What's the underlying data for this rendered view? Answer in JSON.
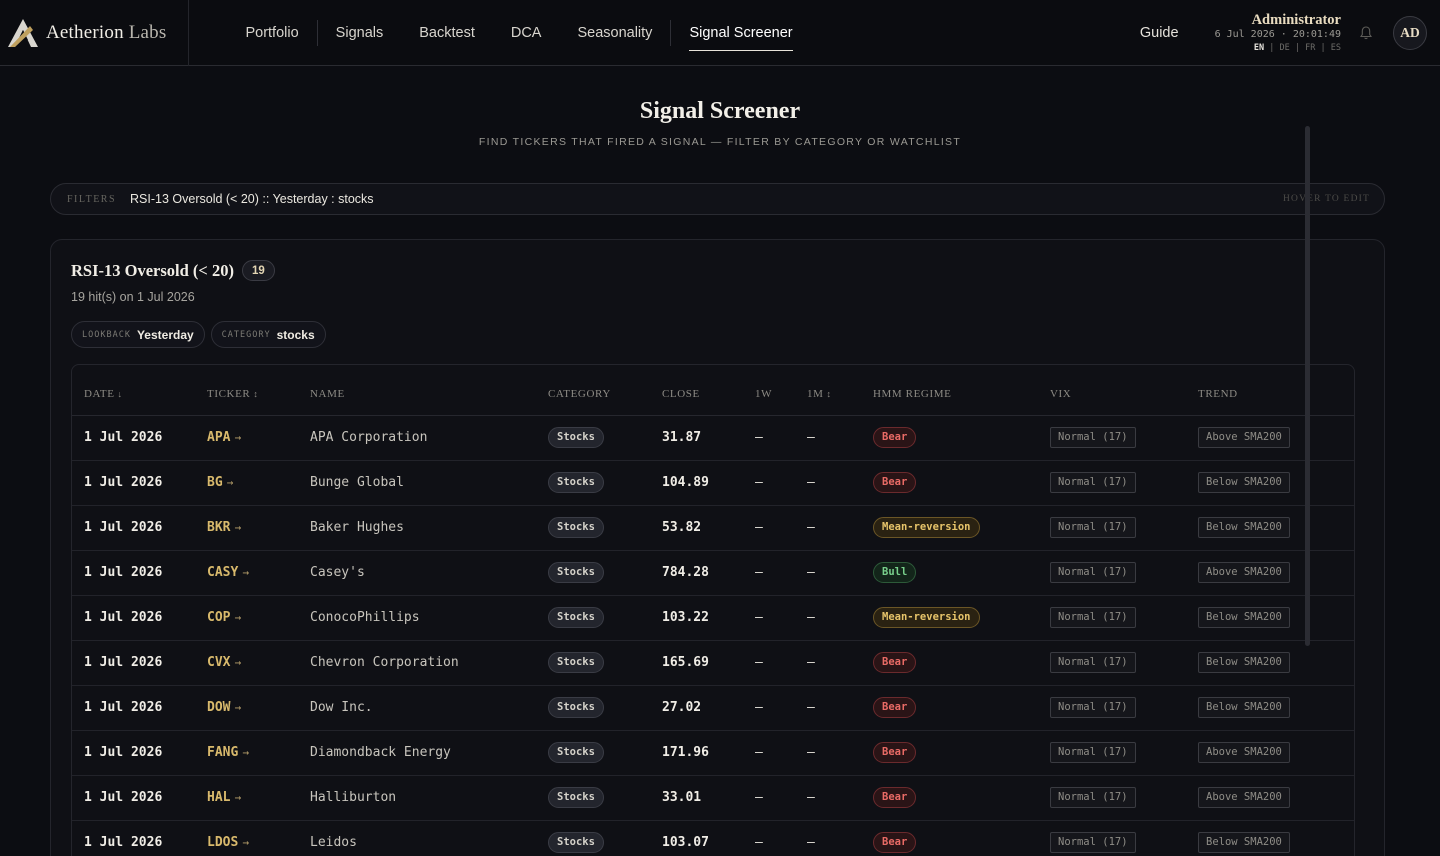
{
  "brand": {
    "name_bold": "Aetherion",
    "name_light": "Labs"
  },
  "nav": {
    "items": [
      {
        "label": "Portfolio"
      },
      {
        "label": "Signals"
      },
      {
        "label": "Backtest"
      },
      {
        "label": "DCA"
      },
      {
        "label": "Seasonality"
      },
      {
        "label": "Signal Screener",
        "active": true
      }
    ],
    "guide": "Guide"
  },
  "user": {
    "name": "Administrator",
    "datetime": "6 Jul 2026 · 20:01:49",
    "initials": "AD",
    "languages": [
      "EN",
      "DE",
      "FR",
      "ES"
    ],
    "active_language": "EN"
  },
  "header": {
    "title": "Signal Screener",
    "subtitle": "FIND TICKERS THAT FIRED A SIGNAL — FILTER BY CATEGORY OR WATCHLIST"
  },
  "filters": {
    "label": "FILTERS",
    "value": "RSI-13 Oversold (< 20) :: Yesterday : stocks",
    "hint": "HOVER TO EDIT"
  },
  "card": {
    "title": "RSI-13 Oversold (< 20)",
    "count": "19",
    "subtitle": "19 hit(s) on 1 Jul 2026",
    "chips": [
      {
        "key": "LOOKBACK",
        "value": "Yesterday"
      },
      {
        "key": "CATEGORY",
        "value": "stocks"
      }
    ]
  },
  "table": {
    "columns": [
      "DATE",
      "TICKER",
      "NAME",
      "CATEGORY",
      "CLOSE",
      "1W",
      "1M",
      "HMM REGIME",
      "VIX",
      "TREND"
    ],
    "rows": [
      {
        "date": "1 Jul 2026",
        "ticker": "APA",
        "name": "APA Corporation",
        "category": "Stocks",
        "close": "31.87",
        "w1": "—",
        "m1": "—",
        "regime": "Bear",
        "vix": "Normal (17)",
        "trend": "Above SMA200"
      },
      {
        "date": "1 Jul 2026",
        "ticker": "BG",
        "name": "Bunge Global",
        "category": "Stocks",
        "close": "104.89",
        "w1": "—",
        "m1": "—",
        "regime": "Bear",
        "vix": "Normal (17)",
        "trend": "Below SMA200"
      },
      {
        "date": "1 Jul 2026",
        "ticker": "BKR",
        "name": "Baker Hughes",
        "category": "Stocks",
        "close": "53.82",
        "w1": "—",
        "m1": "—",
        "regime": "Mean-reversion",
        "vix": "Normal (17)",
        "trend": "Below SMA200"
      },
      {
        "date": "1 Jul 2026",
        "ticker": "CASY",
        "name": "Casey's",
        "category": "Stocks",
        "close": "784.28",
        "w1": "—",
        "m1": "—",
        "regime": "Bull",
        "vix": "Normal (17)",
        "trend": "Above SMA200"
      },
      {
        "date": "1 Jul 2026",
        "ticker": "COP",
        "name": "ConocoPhillips",
        "category": "Stocks",
        "close": "103.22",
        "w1": "—",
        "m1": "—",
        "regime": "Mean-reversion",
        "vix": "Normal (17)",
        "trend": "Below SMA200"
      },
      {
        "date": "1 Jul 2026",
        "ticker": "CVX",
        "name": "Chevron Corporation",
        "category": "Stocks",
        "close": "165.69",
        "w1": "—",
        "m1": "—",
        "regime": "Bear",
        "vix": "Normal (17)",
        "trend": "Below SMA200"
      },
      {
        "date": "1 Jul 2026",
        "ticker": "DOW",
        "name": "Dow Inc.",
        "category": "Stocks",
        "close": "27.02",
        "w1": "—",
        "m1": "—",
        "regime": "Bear",
        "vix": "Normal (17)",
        "trend": "Below SMA200"
      },
      {
        "date": "1 Jul 2026",
        "ticker": "FANG",
        "name": "Diamondback Energy",
        "category": "Stocks",
        "close": "171.96",
        "w1": "—",
        "m1": "—",
        "regime": "Bear",
        "vix": "Normal (17)",
        "trend": "Above SMA200"
      },
      {
        "date": "1 Jul 2026",
        "ticker": "HAL",
        "name": "Halliburton",
        "category": "Stocks",
        "close": "33.01",
        "w1": "—",
        "m1": "—",
        "regime": "Bear",
        "vix": "Normal (17)",
        "trend": "Above SMA200"
      },
      {
        "date": "1 Jul 2026",
        "ticker": "LDOS",
        "name": "Leidos",
        "category": "Stocks",
        "close": "103.07",
        "w1": "—",
        "m1": "—",
        "regime": "Bear",
        "vix": "Normal (17)",
        "trend": "Below SMA200"
      }
    ]
  },
  "colors": {
    "background": "#0c0d12",
    "accent_gold": "#d8b96c",
    "bear": "#ea6b66",
    "bull": "#78cf8b",
    "mean_reversion": "#e7c46a"
  }
}
